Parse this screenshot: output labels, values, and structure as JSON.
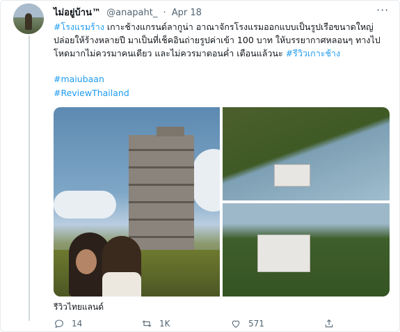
{
  "tweet": {
    "display_name": "ไม่อยู่บ้าน™",
    "handle": "@anapaht_",
    "separator": "·",
    "date": "Apr 18",
    "more_icon": "more-horizontal-icon",
    "text_hashtag_1": "#โรงแรมร้าง",
    "text_body": " เกาะช้างแกรนด์ลากูน่า อาณาจักรโรงแรมออกแบบเป็นรูปเรือขนาดใหญ่ปล่อยให้ร้างหลายปี มาเป็นที่เช็คอินถ่ายรูปค่าเข้า 100 บาท ให้บรรยากาศหลอนๆ ทางไปโหดมากไม่ควรมาคนเดียว และไม่ควรมาตอนค่ำ เตือนแล้วนะ ",
    "text_hashtag_2": "#รีวิวเกาะช้าง",
    "hashtag_3": "#maiubaan",
    "hashtag_4": "#ReviewThailand",
    "media_caption": "รีวิวไทยแลนด์"
  },
  "actions": {
    "reply_count": "14",
    "retweet_count": "1K",
    "like_count": "571",
    "reply_icon": "reply-icon",
    "retweet_icon": "retweet-icon",
    "like_icon": "heart-icon",
    "share_icon": "share-icon"
  },
  "colors": {
    "link": "#1d9bf0",
    "muted": "#536471",
    "text": "#0f1419"
  }
}
